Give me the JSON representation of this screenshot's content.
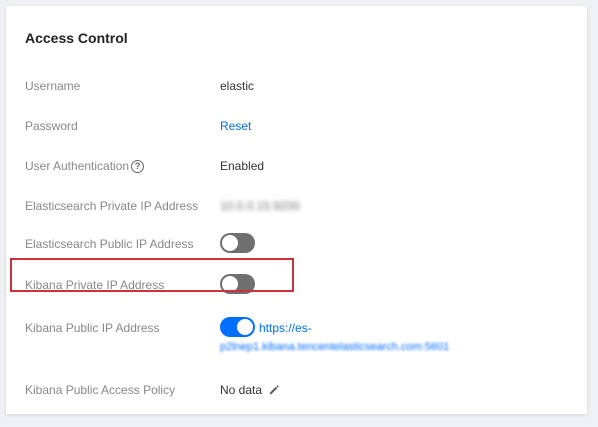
{
  "card": {
    "title": "Access Control"
  },
  "rows": {
    "username": {
      "label": "Username",
      "value": "elastic"
    },
    "password": {
      "label": "Password",
      "action": "Reset"
    },
    "user_auth": {
      "label": "User Authentication",
      "value": "Enabled",
      "help_icon": "?"
    },
    "es_private_ip": {
      "label": "Elasticsearch Private IP Address",
      "value": "10.0.0.15:9200"
    },
    "es_public_ip": {
      "label": "Elasticsearch Public IP Address",
      "enabled": false
    },
    "kibana_private_ip": {
      "label": "Kibana Private IP Address",
      "enabled": false
    },
    "kibana_public_ip": {
      "label": "Kibana Public IP Address",
      "enabled": true,
      "link_line1": "https://es-",
      "link_line2": "p2lnep1.kibana.tencentelasticsearch.com:5601"
    },
    "kibana_policy": {
      "label": "Kibana Public Access Policy",
      "value": "No data"
    }
  },
  "colors": {
    "link": "#006eff",
    "toggle_off": "#6f6f6f",
    "toggle_on": "#006eff",
    "highlight": "#d0303a"
  },
  "icons": {
    "help": "question-circle-icon",
    "edit": "pencil-icon"
  }
}
